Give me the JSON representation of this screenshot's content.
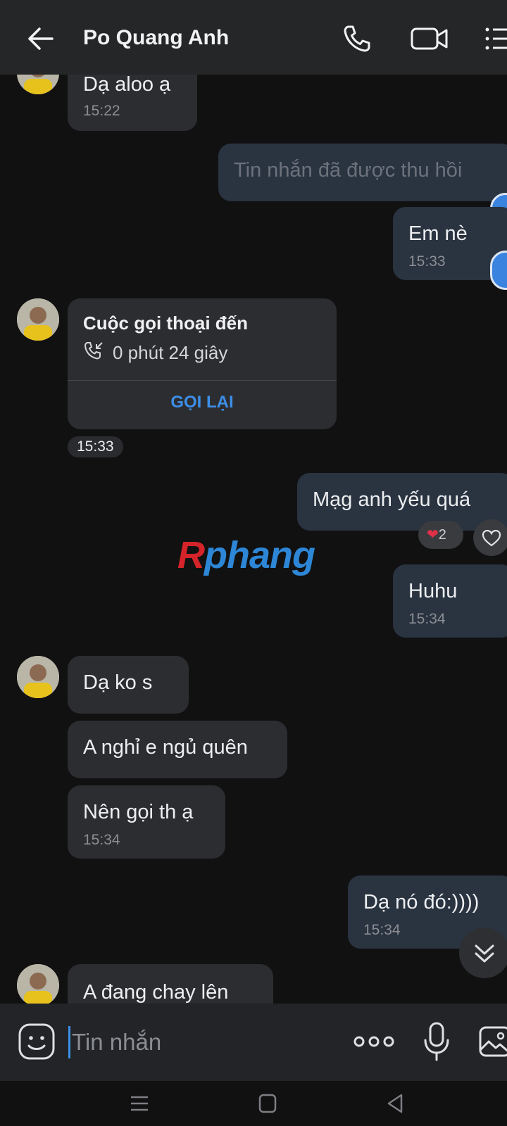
{
  "header": {
    "title": "Po Quang Anh",
    "back_icon": "arrow-left-icon",
    "call_icon": "phone-icon",
    "video_icon": "video-camera-icon",
    "menu_icon": "list-menu-icon"
  },
  "messages": {
    "m1": {
      "text": "Dạ aloo ạ",
      "time": "15:22"
    },
    "m2": {
      "text": "Tin nhắn đã được thu hồi"
    },
    "m3": {
      "text": "Em nè",
      "time": "15:33"
    },
    "call": {
      "title": "Cuộc gọi thoại đến",
      "duration": "0 phút 24 giây",
      "action": "GỌI LẠI",
      "time": "15:33"
    },
    "m4": {
      "text": "Mạg anh yếu quá",
      "reaction_count": "2"
    },
    "m5": {
      "text": "Huhu",
      "time": "15:34"
    },
    "m6": {
      "text": "Dạ ko s"
    },
    "m7": {
      "text": "A nghỉ e ngủ quên"
    },
    "m8": {
      "text": "Nên gọi th ạ",
      "time": "15:34"
    },
    "m9": {
      "text": "Dạ nó đó:))))",
      "time": "15:34"
    },
    "m10": {
      "text": "A đang chay lên"
    }
  },
  "watermark": {
    "part1": "R",
    "part2": "phang"
  },
  "composer": {
    "placeholder": "Tin nhắn"
  },
  "colors": {
    "accent": "#3d8fe8",
    "incoming_bubble": "#2c2d30",
    "outgoing_bubble": "#2a3340",
    "background": "#111112"
  }
}
